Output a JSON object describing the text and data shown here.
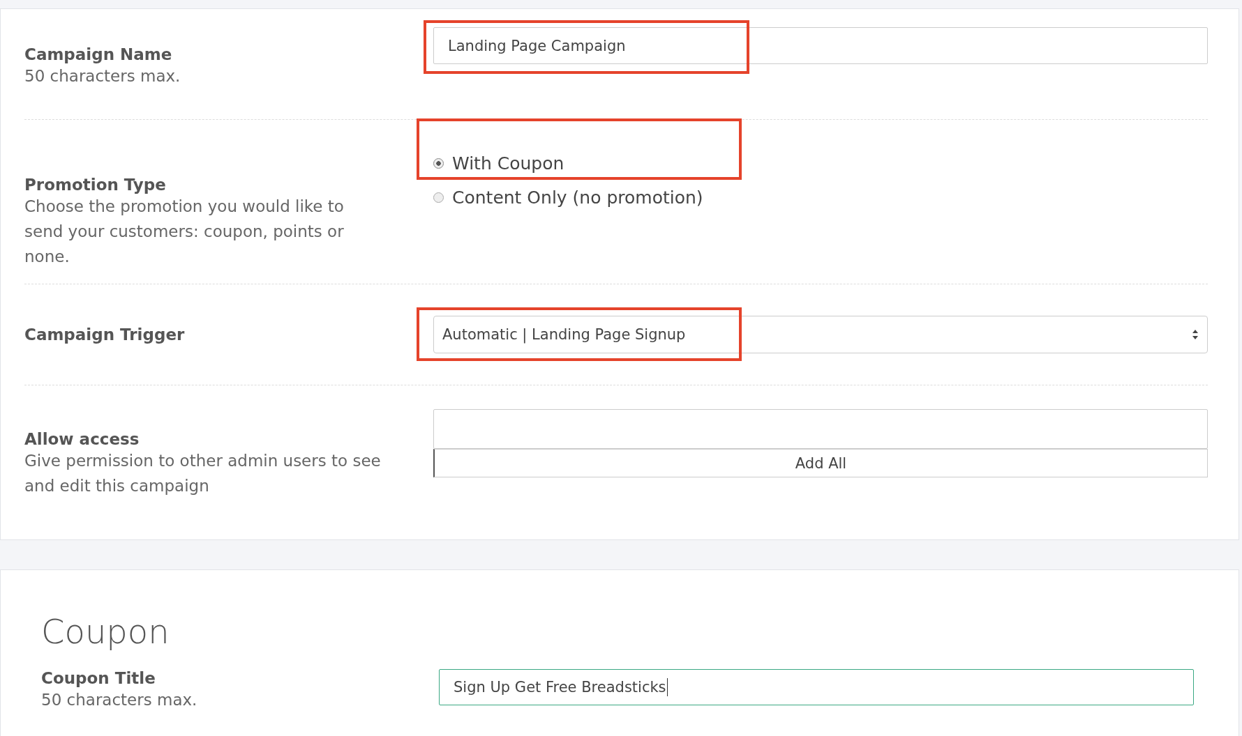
{
  "settings": {
    "rows": [
      {
        "kind": "text",
        "label": "Campaign Name",
        "hint": "50 characters max.",
        "value": "Landing Page Campaign",
        "highlighted": true
      },
      {
        "kind": "radio",
        "label": "Promotion Type",
        "hint": "Choose the promotion you would like to send your customers: coupon, points or none.",
        "highlighted": true,
        "options": [
          {
            "label": "With Coupon",
            "selected": true
          },
          {
            "label": "Content Only (no promotion)",
            "selected": false
          }
        ]
      },
      {
        "kind": "select",
        "label": "Campaign Trigger",
        "value": "Automatic | Landing Page Signup",
        "highlighted": true
      },
      {
        "kind": "access",
        "label": "Allow access",
        "hint": "Give permission to other admin users to see and edit this campaign",
        "button": "Add All"
      }
    ]
  },
  "coupon": {
    "heading": "Coupon",
    "label": "Coupon Title",
    "hint": "50 characters max.",
    "value": "Sign Up Get Free Breadsticks",
    "focused": true
  }
}
